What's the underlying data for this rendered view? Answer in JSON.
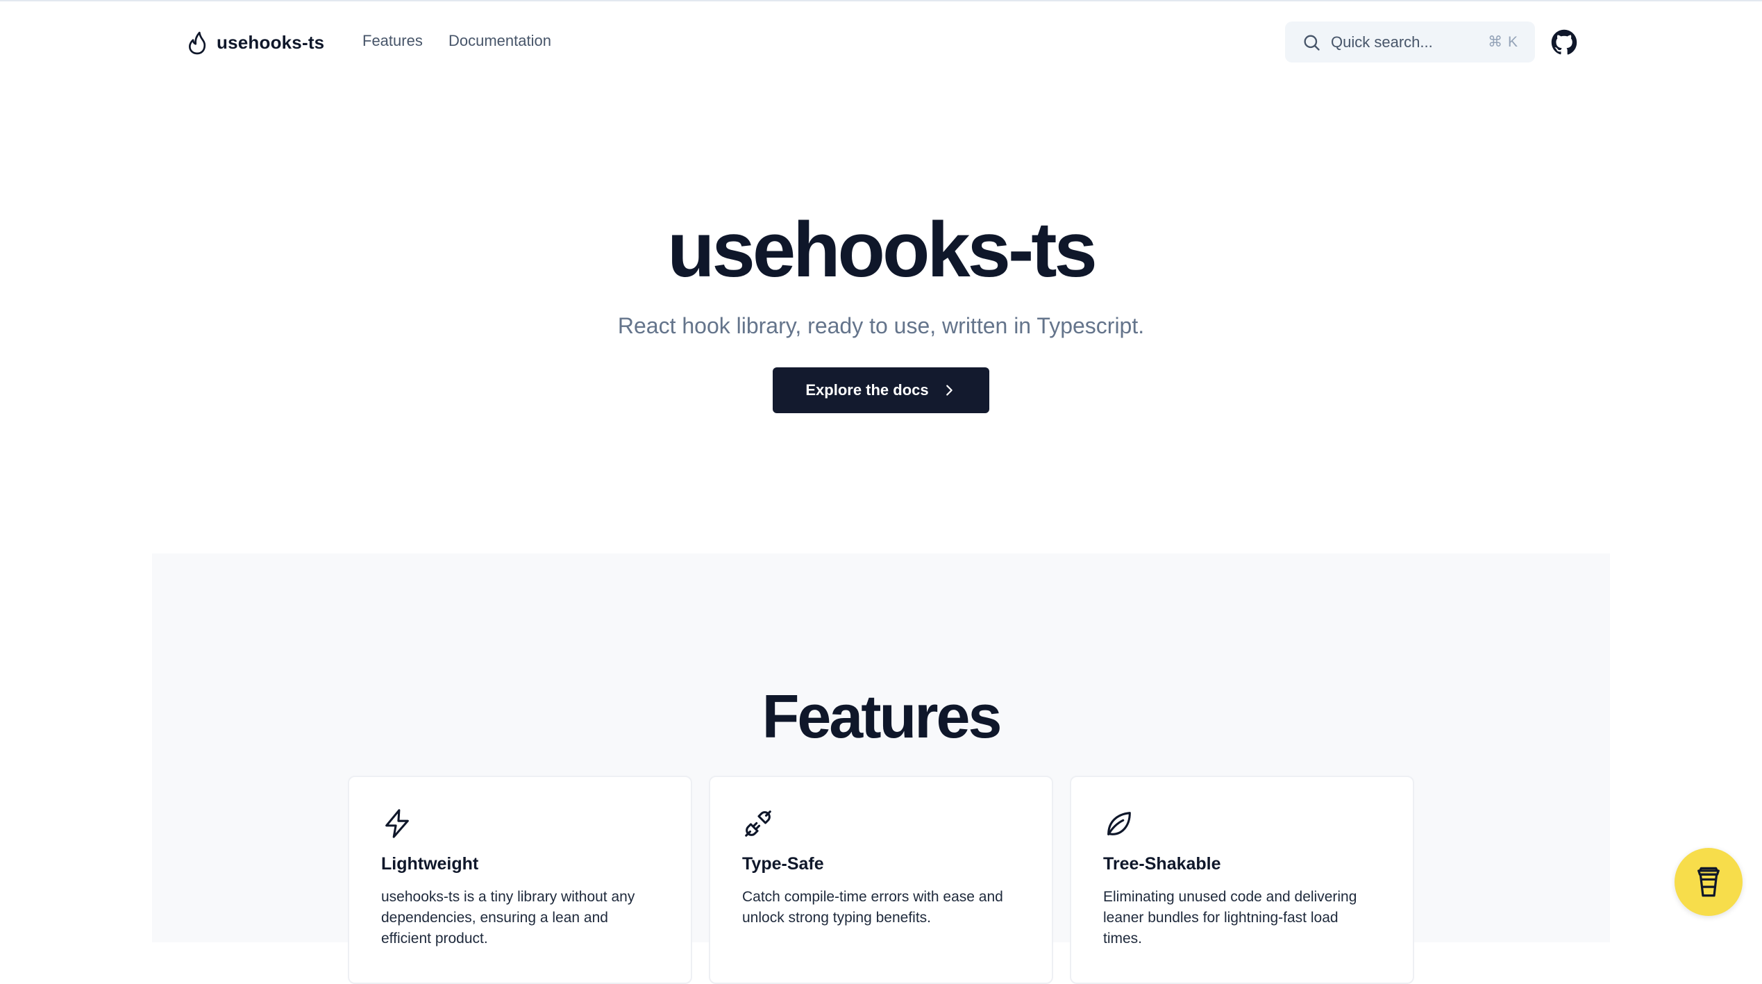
{
  "header": {
    "brand_name": "usehooks-ts",
    "nav": [
      {
        "label": "Features"
      },
      {
        "label": "Documentation"
      }
    ],
    "search": {
      "placeholder": "Quick search...",
      "shortcut": "⌘ K"
    },
    "github_icon": "github-icon"
  },
  "hero": {
    "title": "usehooks-ts",
    "subtitle": "React hook library, ready to use, written in Typescript.",
    "cta_label": "Explore the docs",
    "cta_icon": "chevron-right-icon"
  },
  "features": {
    "title": "Features",
    "cards": [
      {
        "icon": "lightning-icon",
        "title": "Lightweight",
        "text": "usehooks-ts is a tiny library without any dependencies, ensuring a lean and efficient product."
      },
      {
        "icon": "plug-icon",
        "title": "Type-Safe",
        "text": "Catch compile-time errors with ease and unlock strong typing benefits."
      },
      {
        "icon": "leaf-icon",
        "title": "Tree-Shakable",
        "text": "Eliminating unused code and delivering leaner bundles for lightning-fast load times."
      }
    ]
  },
  "floating_button": {
    "icon": "coffee-cup-icon"
  },
  "colors": {
    "primary": "#131a2e",
    "muted_text": "#64748b",
    "section_bg": "#f8f9fb",
    "coffee_bg": "#f7dd4b"
  }
}
